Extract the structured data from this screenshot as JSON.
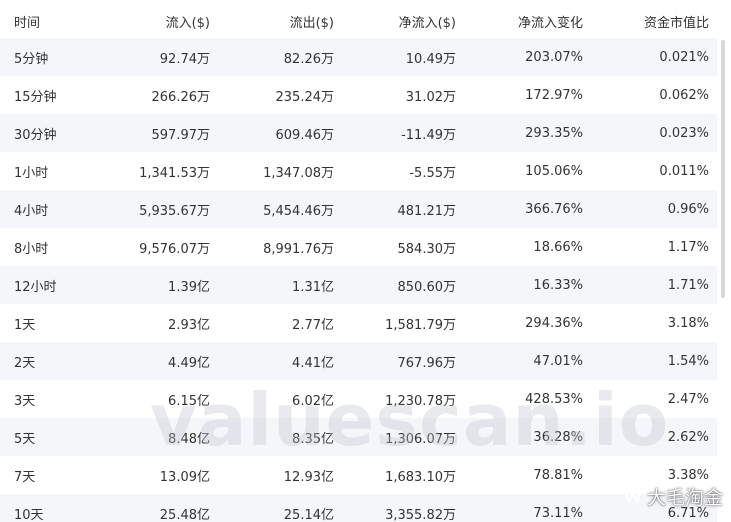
{
  "table": {
    "headers": [
      "时间",
      "流入($)",
      "流出($)",
      "净流入($)",
      "净流入变化",
      "资金市值比"
    ],
    "rows": [
      {
        "time": "5分钟",
        "inflow": "92.74万",
        "outflow": "82.26万",
        "net": "10.49万",
        "net_sign": "pos",
        "change": "203.07%",
        "change_sign": "pos",
        "ratio": "0.021%",
        "ratio_sign": "pos"
      },
      {
        "time": "15分钟",
        "inflow": "266.26万",
        "outflow": "235.24万",
        "net": "31.02万",
        "net_sign": "pos",
        "change": "172.97%",
        "change_sign": "pos",
        "ratio": "0.062%",
        "ratio_sign": "pos"
      },
      {
        "time": "30分钟",
        "inflow": "597.97万",
        "outflow": "609.46万",
        "net": "-11.49万",
        "net_sign": "neg",
        "change": "293.35%",
        "change_sign": "neg",
        "ratio": "0.023%",
        "ratio_sign": "neg"
      },
      {
        "time": "1小时",
        "inflow": "1,341.53万",
        "outflow": "1,347.08万",
        "net": "-5.55万",
        "net_sign": "neg",
        "change": "105.06%",
        "change_sign": "neg",
        "ratio": "0.011%",
        "ratio_sign": "neg"
      },
      {
        "time": "4小时",
        "inflow": "5,935.67万",
        "outflow": "5,454.46万",
        "net": "481.21万",
        "net_sign": "pos",
        "change": "366.76%",
        "change_sign": "pos",
        "ratio": "0.96%",
        "ratio_sign": "pos"
      },
      {
        "time": "8小时",
        "inflow": "9,576.07万",
        "outflow": "8,991.76万",
        "net": "584.30万",
        "net_sign": "pos",
        "change": "18.66%",
        "change_sign": "neg",
        "ratio": "1.17%",
        "ratio_sign": "pos"
      },
      {
        "time": "12小时",
        "inflow": "1.39亿",
        "outflow": "1.31亿",
        "net": "850.60万",
        "net_sign": "pos",
        "change": "16.33%",
        "change_sign": "pos",
        "ratio": "1.71%",
        "ratio_sign": "pos"
      },
      {
        "time": "1天",
        "inflow": "2.93亿",
        "outflow": "2.77亿",
        "net": "1,581.79万",
        "net_sign": "pos",
        "change": "294.36%",
        "change_sign": "pos",
        "ratio": "3.18%",
        "ratio_sign": "pos"
      },
      {
        "time": "2天",
        "inflow": "4.49亿",
        "outflow": "4.41亿",
        "net": "767.96万",
        "net_sign": "pos",
        "change": "47.01%",
        "change_sign": "pos",
        "ratio": "1.54%",
        "ratio_sign": "pos"
      },
      {
        "time": "3天",
        "inflow": "6.15亿",
        "outflow": "6.02亿",
        "net": "1,230.78万",
        "net_sign": "pos",
        "change": "428.53%",
        "change_sign": "pos",
        "ratio": "2.47%",
        "ratio_sign": "pos"
      },
      {
        "time": "5天",
        "inflow": "8.48亿",
        "outflow": "8.35亿",
        "net": "1,306.07万",
        "net_sign": "pos",
        "change": "36.28%",
        "change_sign": "neg",
        "ratio": "2.62%",
        "ratio_sign": "pos"
      },
      {
        "time": "7天",
        "inflow": "13.09亿",
        "outflow": "12.93亿",
        "net": "1,683.10万",
        "net_sign": "pos",
        "change": "78.81%",
        "change_sign": "neg",
        "ratio": "3.38%",
        "ratio_sign": "pos"
      },
      {
        "time": "10天",
        "inflow": "25.48亿",
        "outflow": "25.14亿",
        "net": "3,355.82万",
        "net_sign": "pos",
        "change": "73.11%",
        "change_sign": "neg",
        "ratio": "6.71%",
        "ratio_sign": "pos"
      }
    ]
  },
  "watermark": {
    "text": "valuescan.io"
  },
  "brand": {
    "text": "大毛淘金",
    "icon": "wechat-channel-icon"
  },
  "colors": {
    "positive": "#1aa85b",
    "negative": "#e0353c",
    "stripe": "#f4f6f9"
  }
}
